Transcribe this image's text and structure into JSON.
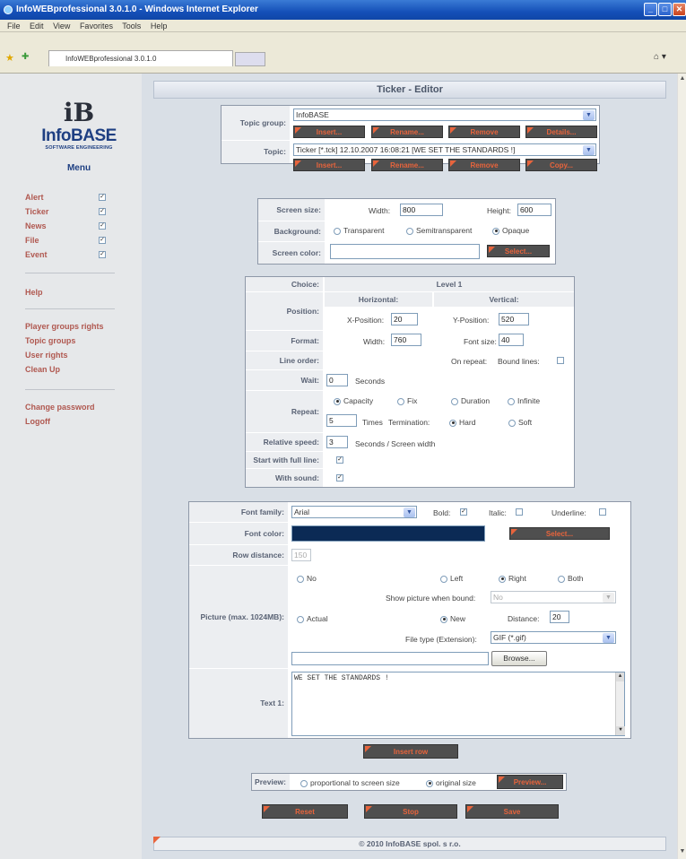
{
  "window": {
    "title": "InfoWEBprofessional 3.0.1.0 - Windows Internet Explorer"
  },
  "menu_bar": [
    "File",
    "Edit",
    "View",
    "Favorites",
    "Tools",
    "Help"
  ],
  "tab": {
    "title": "InfoWEBprofessional 3.0.1.0"
  },
  "logo": {
    "mark": "iB",
    "name": "InfoBASE",
    "sub": "SOFTWARE ENGINEERING"
  },
  "sidebar": {
    "menu_title": "Menu",
    "items": [
      {
        "label": "Alert",
        "checked": true
      },
      {
        "label": "Ticker",
        "checked": true
      },
      {
        "label": "News",
        "checked": true
      },
      {
        "label": "File",
        "checked": true
      },
      {
        "label": "Event",
        "checked": true
      }
    ],
    "help": "Help",
    "links": [
      "Player groups rights",
      "Topic groups",
      "User rights",
      "Clean Up"
    ],
    "account": [
      "Change password",
      "Logoff"
    ]
  },
  "page_title": "Ticker - Editor",
  "topic_group": {
    "label": "Topic group:",
    "value": "InfoBASE",
    "buttons": [
      "Insert...",
      "Rename...",
      "Remove",
      "Details..."
    ]
  },
  "topic": {
    "label": "Topic:",
    "value": "Ticker [*.tck]   12.10.2007 16:08:21   [WE SET THE STANDARDS !]",
    "buttons": [
      "Insert...",
      "Rename...",
      "Remove",
      "Copy..."
    ]
  },
  "screen": {
    "size_label": "Screen size:",
    "width_label": "Width:",
    "width": "800",
    "height_label": "Height:",
    "height": "600",
    "background_label": "Background:",
    "bg_options": [
      "Transparent",
      "Semitransparent",
      "Opaque"
    ],
    "bg_selected": "Opaque",
    "color_label": "Screen color:",
    "select_button": "Select..."
  },
  "level": {
    "choice_label": "Choice:",
    "choice_value": "Level 1",
    "position_label": "Position:",
    "horizontal": "Horizontal:",
    "vertical": "Vertical:",
    "x_label": "X-Position:",
    "x": "20",
    "y_label": "Y-Position:",
    "y": "520",
    "format_label": "Format:",
    "fwidth_label": "Width:",
    "fwidth": "760",
    "fsize_label": "Font size:",
    "fsize": "40",
    "line_order_label": "Line order:",
    "on_repeat": "On repeat:",
    "bound_lines": "Bound lines:",
    "wait_label": "Wait:",
    "wait": "0",
    "seconds": "Seconds",
    "repeat_label": "Repeat:",
    "repeat_options": [
      "Capacity",
      "Fix",
      "Duration",
      "Infinite"
    ],
    "times": "5",
    "times_label": "Times",
    "termination_label": "Termination:",
    "term_options": [
      "Hard",
      "Soft"
    ],
    "speed_label": "Relative speed:",
    "speed": "3",
    "speed_unit": "Seconds / Screen width",
    "full_line_label": "Start with full line:",
    "sound_label": "With sound:"
  },
  "font": {
    "family_label": "Font family:",
    "family": "Arial",
    "bold": "Bold:",
    "italic": "Italic:",
    "underline": "Underline:",
    "color_label": "Font color:",
    "color": "#0b2a55",
    "select_button": "Select...",
    "row_distance_label": "Row distance:",
    "row_distance": "150",
    "picture_label": "Picture (max. 1024MB):",
    "pic_options": [
      "No",
      "Left",
      "Right",
      "Both"
    ],
    "show_when_bound": "Show picture when bound:",
    "bound_value": "No",
    "actual": "Actual",
    "new": "New",
    "distance_label": "Distance:",
    "distance": "20",
    "filetype_label": "File type (Extension):",
    "filetype": "GIF (*.gif)",
    "browse": "Browse...",
    "text_label": "Text 1:",
    "text": "WE SET THE STANDARDS !"
  },
  "insert_row": "Insert row",
  "preview": {
    "label": "Preview:",
    "options": [
      "proportional to screen size",
      "original size"
    ],
    "button": "Preview..."
  },
  "actions": [
    "Reset",
    "Stop",
    "Save"
  ],
  "footer": "© 2010 InfoBASE spol. s r.o."
}
